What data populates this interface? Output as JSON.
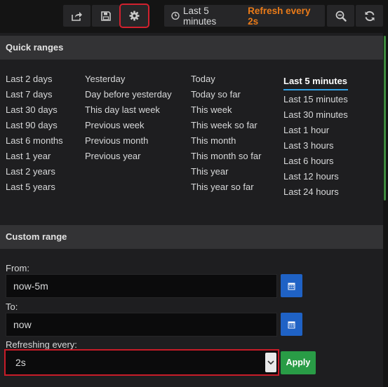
{
  "toolbar": {
    "share_icon": "share-icon",
    "save_icon": "save-icon",
    "settings_icon": "gear-icon",
    "time_range_label": "Last 5 minutes",
    "refresh_label": "Refresh every 2s",
    "zoom_icon": "zoom-out-icon",
    "refresh_icon": "refresh-icon",
    "highlight_color": "#d1212e"
  },
  "quick_ranges": {
    "title": "Quick ranges",
    "columns": [
      [
        "Last 2 days",
        "Last 7 days",
        "Last 30 days",
        "Last 90 days",
        "Last 6 months",
        "Last 1 year",
        "Last 2 years",
        "Last 5 years"
      ],
      [
        "Yesterday",
        "Day before yesterday",
        "This day last week",
        "Previous week",
        "Previous month",
        "Previous year"
      ],
      [
        "Today",
        "Today so far",
        "This week",
        "This week so far",
        "This month",
        "This month so far",
        "This year",
        "This year so far"
      ],
      [
        "Last 5 minutes",
        "Last 15 minutes",
        "Last 30 minutes",
        "Last 1 hour",
        "Last 3 hours",
        "Last 6 hours",
        "Last 12 hours",
        "Last 24 hours"
      ]
    ],
    "active": "Last 5 minutes"
  },
  "custom_range": {
    "title": "Custom range",
    "from_label": "From:",
    "from_value": "now-5m",
    "to_label": "To:",
    "to_value": "now",
    "refresh_label": "Refreshing every:",
    "refresh_value": "2s",
    "apply_label": "Apply",
    "accent_colors": {
      "calendar": "#1f62c5",
      "apply": "#299c46",
      "orange": "#eb7b18"
    }
  }
}
